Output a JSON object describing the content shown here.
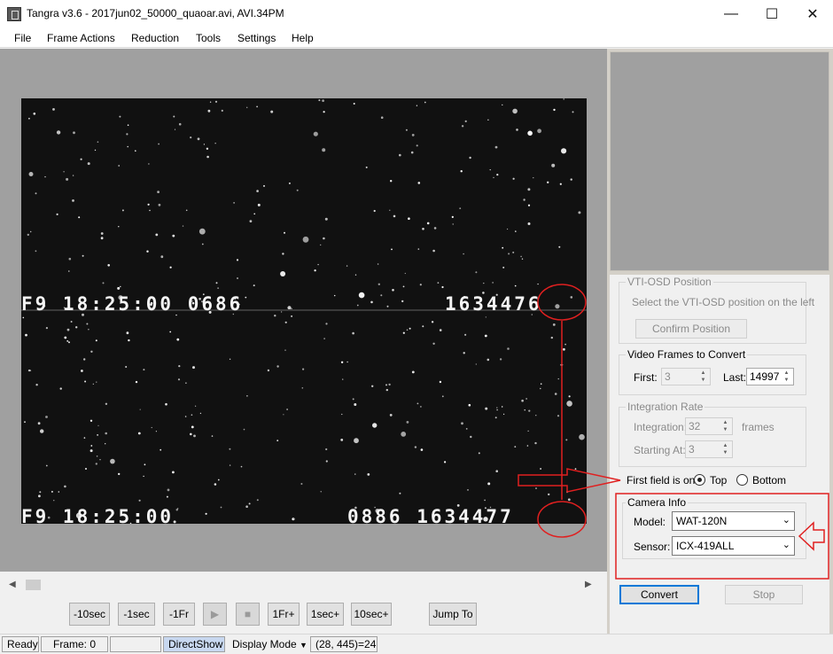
{
  "window": {
    "title": "Tangra v3.6 - 2017jun02_50000_quaoar.avi, AVI.34PM"
  },
  "menu": [
    "File",
    "Frame Actions",
    "Reduction",
    "Tools",
    "Settings",
    "Help"
  ],
  "osd": {
    "line1_left": "F9 18:25:00 0686",
    "line1_right": "1634476",
    "line2_left": "F9 18:25:00",
    "line2_right": "0886 1634477"
  },
  "nav_buttons": [
    "-10sec",
    "-1sec",
    "-1Fr",
    "1Fr+",
    "1sec+",
    "10sec+"
  ],
  "jump_to": "Jump To",
  "status": {
    "ready": "Ready",
    "frame": "Frame: 0",
    "blank": "",
    "renderer": "DirectShow",
    "display_mode": "Display Mode",
    "pixel": "(28, 445)=24"
  },
  "vti": {
    "title": "VTI-OSD Position",
    "instruction": "Select the VTI-OSD position on the left",
    "confirm": "Confirm Position"
  },
  "frames": {
    "title": "Video Frames to Convert",
    "first_label": "First:",
    "first_value": "3",
    "last_label": "Last:",
    "last_value": "14997"
  },
  "integration": {
    "title": "Integration Rate",
    "integration_label": "Integration:",
    "integration_value": "32",
    "frames_unit": "frames",
    "starting_label": "Starting At:",
    "starting_value": "3"
  },
  "field": {
    "label": "First field is on:",
    "top": "Top",
    "bottom": "Bottom",
    "selected": "Top"
  },
  "camera": {
    "title": "Camera Info",
    "model_label": "Model:",
    "model_value": "WAT-120N",
    "sensor_label": "Sensor:",
    "sensor_value": "ICX-419ALL"
  },
  "actions": {
    "convert": "Convert",
    "stop": "Stop"
  },
  "colors": {
    "annotation": "#e02020",
    "video_bg": "#a0a0a0",
    "panel_bg": "#d4d0c8"
  }
}
